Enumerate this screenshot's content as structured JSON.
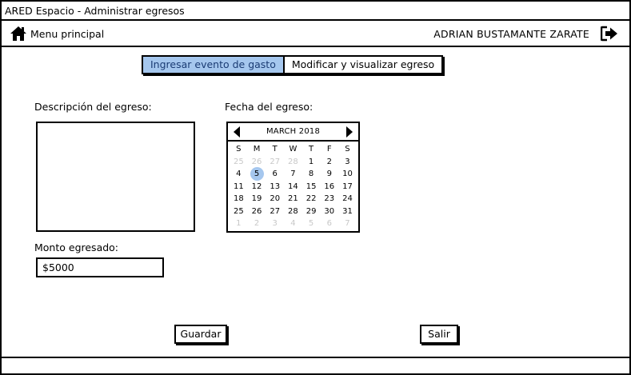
{
  "window": {
    "title": "ARED Espacio - Administrar egresos"
  },
  "navbar": {
    "home_label": "Menu principal",
    "home_icon": "home-icon",
    "user_name": "ADRIAN BUSTAMANTE ZARATE",
    "logout_icon": "logout-icon"
  },
  "tabs": [
    {
      "label": "Ingresar evento de gasto",
      "active": true
    },
    {
      "label": "Modificar y visualizar egreso",
      "active": false
    }
  ],
  "form": {
    "description_label": "Descripción del egreso:",
    "description_value": "",
    "date_label": "Fecha del egreso:",
    "amount_label": "Monto egresado:",
    "amount_value": "$5000"
  },
  "calendar": {
    "month_label": "MARCH 2018",
    "weekdays": [
      "S",
      "M",
      "T",
      "W",
      "T",
      "F",
      "S"
    ],
    "selected_day": "5",
    "selected_color": "#a5c7ee",
    "weeks": [
      [
        {
          "d": "25",
          "m": true
        },
        {
          "d": "26",
          "m": true
        },
        {
          "d": "27",
          "m": true
        },
        {
          "d": "28",
          "m": true
        },
        {
          "d": "1"
        },
        {
          "d": "2"
        },
        {
          "d": "3"
        }
      ],
      [
        {
          "d": "4"
        },
        {
          "d": "5"
        },
        {
          "d": "6"
        },
        {
          "d": "7"
        },
        {
          "d": "8"
        },
        {
          "d": "9"
        },
        {
          "d": "10"
        }
      ],
      [
        {
          "d": "11"
        },
        {
          "d": "12"
        },
        {
          "d": "13"
        },
        {
          "d": "14"
        },
        {
          "d": "15"
        },
        {
          "d": "16"
        },
        {
          "d": "17"
        }
      ],
      [
        {
          "d": "18"
        },
        {
          "d": "19"
        },
        {
          "d": "20"
        },
        {
          "d": "21"
        },
        {
          "d": "22"
        },
        {
          "d": "23"
        },
        {
          "d": "24"
        }
      ],
      [
        {
          "d": "25"
        },
        {
          "d": "26"
        },
        {
          "d": "27"
        },
        {
          "d": "28"
        },
        {
          "d": "29"
        },
        {
          "d": "30"
        },
        {
          "d": "31"
        }
      ],
      [
        {
          "d": "1",
          "m": true
        },
        {
          "d": "2",
          "m": true
        },
        {
          "d": "3",
          "m": true
        },
        {
          "d": "4",
          "m": true
        },
        {
          "d": "5",
          "m": true
        },
        {
          "d": "6",
          "m": true
        },
        {
          "d": "7",
          "m": true
        }
      ]
    ]
  },
  "actions": {
    "save_label": "Guardar",
    "exit_label": "Salir"
  },
  "colors": {
    "accent": "#a5c7ee",
    "accent_text": "#1a3b73",
    "border": "#000000"
  }
}
